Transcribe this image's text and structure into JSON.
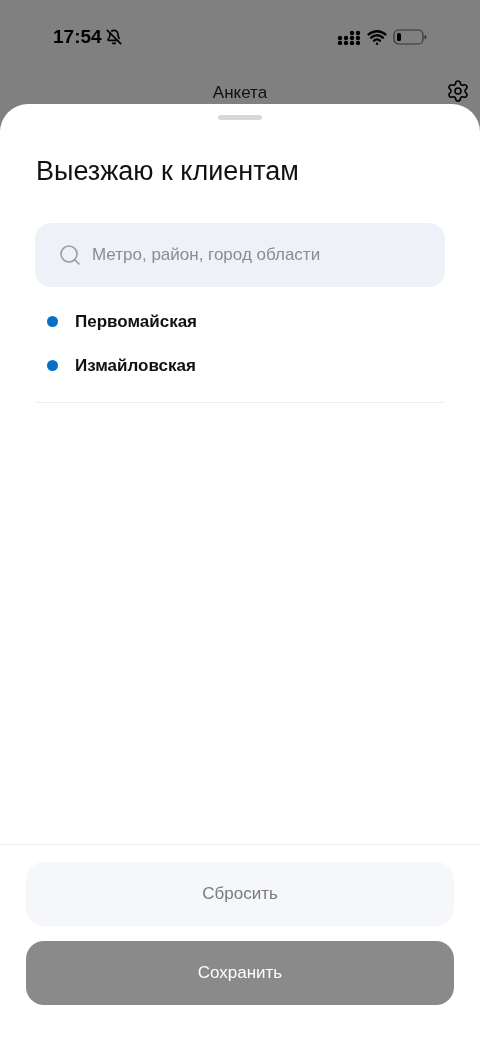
{
  "status_bar": {
    "time": "17:54",
    "silent": true
  },
  "header": {
    "title": "Анкета"
  },
  "sheet": {
    "title": "Выезжаю к клиентам",
    "search": {
      "placeholder": "Метро, район, город области"
    },
    "stations": [
      {
        "name": "Первомайская",
        "color": "#0a6fc2"
      },
      {
        "name": "Измайловская",
        "color": "#0a6fc2"
      }
    ]
  },
  "buttons": [
    {
      "label": "Сбросить",
      "kind": "secondary",
      "disabled": false
    },
    {
      "label": "Сохранить",
      "kind": "primary",
      "disabled": true
    }
  ]
}
